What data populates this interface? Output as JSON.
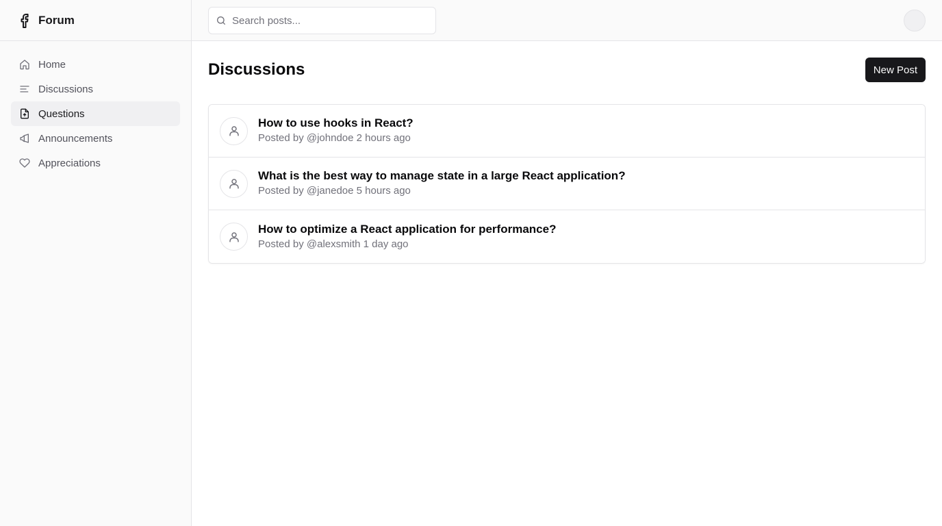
{
  "brand": {
    "name": "Forum",
    "logo_icon": "facebook-f-icon"
  },
  "sidebar": {
    "items": [
      {
        "label": "Home",
        "icon": "home-icon",
        "active": false
      },
      {
        "label": "Discussions",
        "icon": "text-align-icon",
        "active": false
      },
      {
        "label": "Questions",
        "icon": "file-question-icon",
        "active": true
      },
      {
        "label": "Announcements",
        "icon": "megaphone-icon",
        "active": false
      },
      {
        "label": "Appreciations",
        "icon": "heart-icon",
        "active": false
      }
    ]
  },
  "topbar": {
    "search_placeholder": "Search posts...",
    "search_value": ""
  },
  "main": {
    "title": "Discussions",
    "new_post_label": "New Post",
    "posts": [
      {
        "title": "How to use hooks in React?",
        "meta": "Posted by @johndoe 2 hours ago"
      },
      {
        "title": "What is the best way to manage state in a large React application?",
        "meta": "Posted by @janedoe 5 hours ago"
      },
      {
        "title": "How to optimize a React application for performance?",
        "meta": "Posted by @alexsmith 1 day ago"
      }
    ]
  },
  "colors": {
    "accent": "#18181b",
    "sidebar_bg": "#fafafa",
    "border": "#e4e4e7",
    "muted_text": "#71717a"
  }
}
